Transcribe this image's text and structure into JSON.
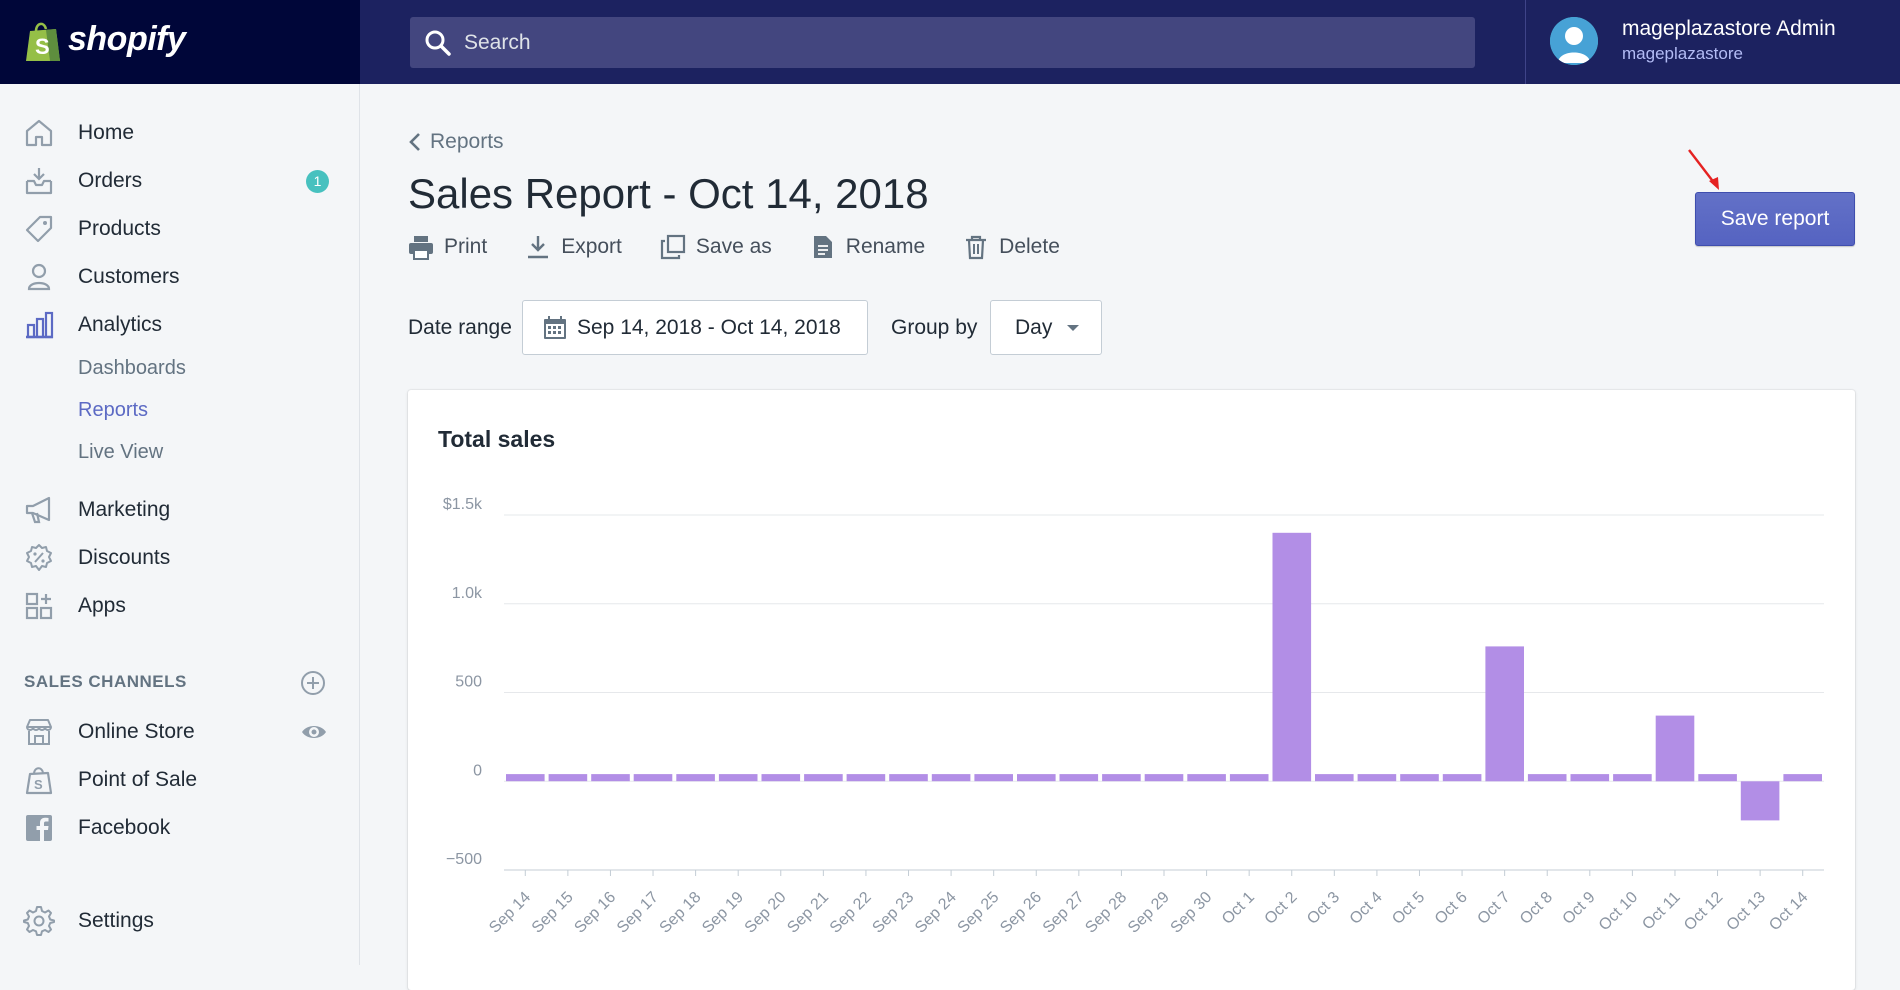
{
  "brand": {
    "name": "shopify"
  },
  "search": {
    "placeholder": "Search"
  },
  "user": {
    "name": "mageplazastore Admin",
    "store": "mageplazastore"
  },
  "sidebar": {
    "items": [
      {
        "label": "Home",
        "icon": "home-icon"
      },
      {
        "label": "Orders",
        "icon": "orders-icon",
        "badge": "1"
      },
      {
        "label": "Products",
        "icon": "tag-icon"
      },
      {
        "label": "Customers",
        "icon": "person-icon"
      },
      {
        "label": "Analytics",
        "icon": "bar-chart-icon",
        "active": true
      }
    ],
    "analytics_sub": [
      "Dashboards",
      "Reports",
      "Live View"
    ],
    "items2": [
      {
        "label": "Marketing",
        "icon": "megaphone-icon"
      },
      {
        "label": "Discounts",
        "icon": "discount-icon"
      },
      {
        "label": "Apps",
        "icon": "apps-icon"
      }
    ],
    "sales_channels_title": "SALES CHANNELS",
    "channels": [
      {
        "label": "Online Store",
        "icon": "store-icon"
      },
      {
        "label": "Point of Sale",
        "icon": "pos-icon"
      },
      {
        "label": "Facebook",
        "icon": "facebook-icon"
      }
    ],
    "settings": "Settings"
  },
  "page": {
    "back_label": "Reports",
    "title": "Sales Report - Oct 14, 2018",
    "actions": [
      "Print",
      "Export",
      "Save as",
      "Rename",
      "Delete"
    ],
    "save_button": "Save report",
    "date_range_label": "Date range",
    "date_range_value": "Sep 14, 2018 - Oct 14, 2018",
    "group_by_label": "Group by",
    "group_by_value": "Day"
  },
  "chart_data": {
    "type": "bar",
    "title": "Total sales",
    "color": "#b28ee6",
    "categories": [
      "Sep 14",
      "Sep 15",
      "Sep 16",
      "Sep 17",
      "Sep 18",
      "Sep 19",
      "Sep 20",
      "Sep 21",
      "Sep 22",
      "Sep 23",
      "Sep 24",
      "Sep 25",
      "Sep 26",
      "Sep 27",
      "Sep 28",
      "Sep 29",
      "Sep 30",
      "Oct 1",
      "Oct 2",
      "Oct 3",
      "Oct 4",
      "Oct 5",
      "Oct 6",
      "Oct 7",
      "Oct 8",
      "Oct 9",
      "Oct 10",
      "Oct 11",
      "Oct 12",
      "Oct 13",
      "Oct 14"
    ],
    "values": [
      40,
      40,
      40,
      40,
      40,
      40,
      40,
      40,
      40,
      40,
      40,
      40,
      40,
      40,
      40,
      40,
      40,
      40,
      1400,
      40,
      40,
      40,
      40,
      760,
      40,
      40,
      40,
      370,
      40,
      -220,
      40
    ],
    "yticks": [
      -500,
      0,
      500,
      1000,
      1500
    ],
    "ytick_labels": [
      "−500",
      "0",
      "500",
      "1.0k",
      "$1.5k"
    ],
    "ylim": [
      -500,
      1500
    ],
    "grid": true
  }
}
